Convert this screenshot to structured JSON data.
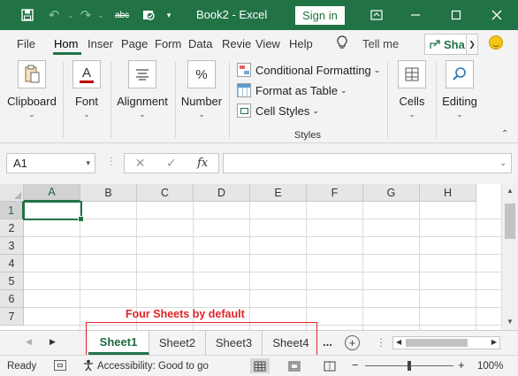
{
  "window": {
    "title": "Book2  -  Excel",
    "signin_label": "Sign in"
  },
  "ribbon_tabs": [
    {
      "label": "File",
      "active": false
    },
    {
      "label": "Hom",
      "active": true
    },
    {
      "label": "Inser",
      "active": false
    },
    {
      "label": "Page",
      "active": false
    },
    {
      "label": "Form",
      "active": false
    },
    {
      "label": "Data",
      "active": false
    },
    {
      "label": "Revie",
      "active": false
    },
    {
      "label": "View",
      "active": false
    },
    {
      "label": "Help",
      "active": false
    }
  ],
  "tell_me": "Tell me",
  "share_label": "Sha",
  "ribbon": {
    "groups": {
      "clipboard": "Clipboard",
      "font": "Font",
      "alignment": "Alignment",
      "number": "Number",
      "cells": "Cells",
      "editing": "Editing"
    },
    "styles": {
      "conditional_formatting": "Conditional Formatting",
      "format_as_table": "Format as Table",
      "cell_styles": "Cell Styles",
      "group_label": "Styles"
    },
    "number_icon_glyph": "%",
    "font_icon_glyph": "A"
  },
  "formula_bar": {
    "name_box": "A1",
    "fx": "fx",
    "formula": ""
  },
  "grid": {
    "columns": [
      "A",
      "B",
      "C",
      "D",
      "E",
      "F",
      "G",
      "H"
    ],
    "rows": [
      "1",
      "2",
      "3",
      "4",
      "5",
      "6",
      "7"
    ],
    "active_cell": "A1"
  },
  "annotation": "Four Sheets by default",
  "sheets": [
    {
      "name": "Sheet1",
      "active": true
    },
    {
      "name": "Sheet2",
      "active": false
    },
    {
      "name": "Sheet3",
      "active": false
    },
    {
      "name": "Sheet4",
      "active": false
    }
  ],
  "sheets_more": "...",
  "add_sheet": "+",
  "status_bar": {
    "ready": "Ready",
    "accessibility": "Accessibility: Good to go",
    "zoom": "100%",
    "zoom_fraction": 0.5
  },
  "colors": {
    "excel_green": "#217346",
    "annotation_red": "#e0242b"
  }
}
